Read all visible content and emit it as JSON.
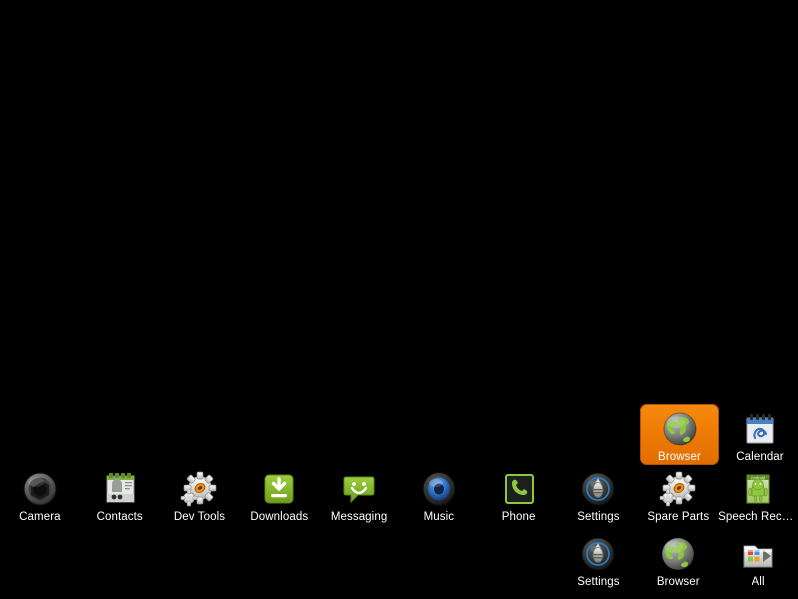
{
  "screen": {
    "name": "android-app-launcher",
    "background_color": "#000000",
    "label_color": "#ffffff",
    "selection_color": "#f07c06",
    "selection_border_color": "#b35400"
  },
  "rows": [
    {
      "row_index": 1,
      "apps": [
        {
          "label": "Camera",
          "icon": "camera-aperture-icon",
          "selected": false
        },
        {
          "label": "Contacts",
          "icon": "contacts-card-icon",
          "selected": false
        },
        {
          "label": "Dev Tools",
          "icon": "gear-orange-icon",
          "selected": false
        },
        {
          "label": "Downloads",
          "icon": "download-arrow-icon",
          "selected": false
        },
        {
          "label": "Messaging",
          "icon": "message-bubble-icon",
          "selected": false
        },
        {
          "label": "Music",
          "icon": "speaker-icon",
          "selected": false
        },
        {
          "label": "Phone",
          "icon": "phone-handset-icon",
          "selected": false
        },
        {
          "label": "Settings",
          "icon": "settings-dial-icon",
          "selected": false
        },
        {
          "label": "Spare Parts",
          "icon": "gear-orange-icon",
          "selected": false
        },
        {
          "label": "Speech Reco...",
          "icon": "android-card-icon",
          "selected": false
        }
      ]
    },
    {
      "row_index": 2,
      "apps": [
        {
          "label": "Settings",
          "icon": "settings-dial-icon",
          "selected": false
        },
        {
          "label": "Browser",
          "icon": "globe-icon",
          "selected": false
        },
        {
          "label": "All",
          "icon": "all-apps-folder-icon",
          "selected": false
        }
      ]
    }
  ],
  "floating": {
    "browser_tile": {
      "label": "Browser",
      "icon": "globe-icon",
      "selected": true
    },
    "calendar_tile": {
      "label": "Calendar",
      "icon": "calendar-icon",
      "selected": false
    }
  }
}
